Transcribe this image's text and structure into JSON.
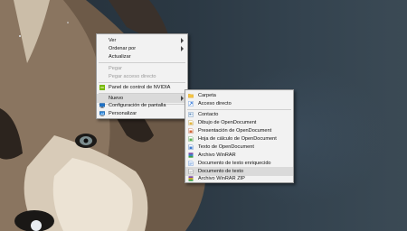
{
  "context_menu": {
    "items": [
      {
        "label": "Ver",
        "has_submenu": true,
        "enabled": true
      },
      {
        "label": "Ordenar por",
        "has_submenu": true,
        "enabled": true
      },
      {
        "label": "Actualizar",
        "has_submenu": false,
        "enabled": true
      },
      {
        "label": "Pegar",
        "has_submenu": false,
        "enabled": false
      },
      {
        "label": "Pegar acceso directo",
        "has_submenu": false,
        "enabled": false
      },
      {
        "label": "Panel de control de NVIDIA",
        "has_submenu": false,
        "enabled": true,
        "icon": "nvidia-icon"
      },
      {
        "label": "Nuevo",
        "has_submenu": true,
        "enabled": true,
        "highlighted": true
      },
      {
        "label": "Configuración de pantalla",
        "has_submenu": false,
        "enabled": true,
        "icon": "display-settings-icon"
      },
      {
        "label": "Personalizar",
        "has_submenu": false,
        "enabled": true,
        "icon": "personalize-icon"
      }
    ]
  },
  "new_submenu": {
    "items": [
      {
        "label": "Carpeta",
        "icon": "folder-icon"
      },
      {
        "label": "Acceso directo",
        "icon": "shortcut-icon"
      },
      {
        "label": "Contacto",
        "icon": "contact-icon"
      },
      {
        "label": "Dibujo de OpenDocument",
        "icon": "odg-icon"
      },
      {
        "label": "Presentación de OpenDocument",
        "icon": "odp-icon"
      },
      {
        "label": "Hoja de cálculo de OpenDocument",
        "icon": "ods-icon"
      },
      {
        "label": "Texto de OpenDocument",
        "icon": "odt-icon"
      },
      {
        "label": "Archivo WinRAR",
        "icon": "winrar-icon"
      },
      {
        "label": "Documento de texto enriquecido",
        "icon": "rtf-icon"
      },
      {
        "label": "Documento de texto",
        "icon": "txt-icon",
        "highlighted": true
      },
      {
        "label": "Archivo WinRAR ZIP",
        "icon": "winrar-zip-icon"
      }
    ]
  },
  "colors": {
    "menu_bg": "#f2f2f2",
    "menu_border": "#9a9a9a",
    "highlight": "#dadada",
    "disabled_text": "#9a9a9a",
    "desktop_bg": "#2b3843"
  }
}
